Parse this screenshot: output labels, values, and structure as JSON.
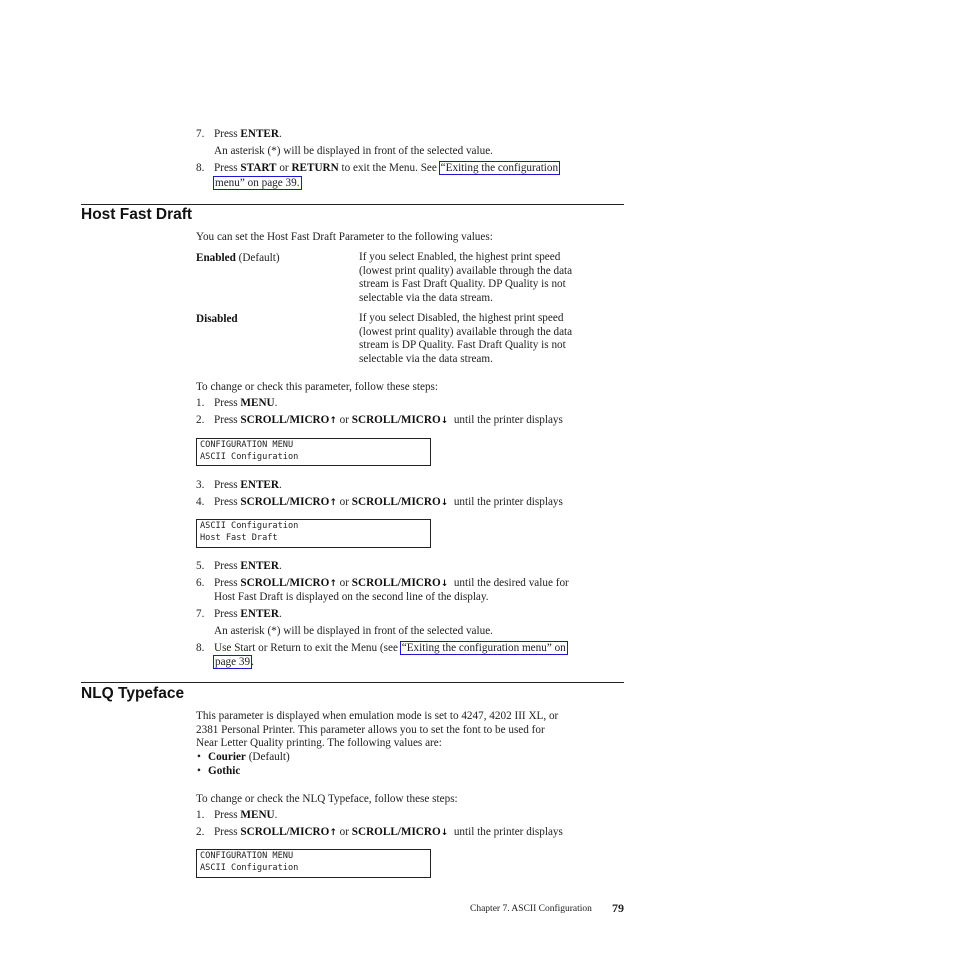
{
  "top_steps": {
    "step7": {
      "num": "7.",
      "pre": "Press ",
      "key": "ENTER",
      "post": "."
    },
    "step7_note": "An asterisk (*) will be displayed in front of the selected value.",
    "step8": {
      "num": "8.",
      "pre": "Press ",
      "key1": "START",
      "mid": " or ",
      "key2": "RETURN",
      "post": " to exit the Menu. See ",
      "link_line1": "“Exiting the configuration",
      "link_line2": "menu” on page 39."
    }
  },
  "host_fast_draft": {
    "title": "Host Fast Draft",
    "intro": "You can set the Host Fast Draft Parameter to the following values:",
    "values": [
      {
        "term": "Enabled",
        "term_suffix": " (Default)",
        "desc": [
          "If you select Enabled, the highest print speed",
          "(lowest print quality) available through the data",
          "stream is Fast Draft Quality. DP Quality is not",
          "selectable via the data stream."
        ]
      },
      {
        "term": "Disabled",
        "term_suffix": "",
        "desc": [
          "If you select Disabled, the highest print speed",
          "(lowest print quality) available through the data",
          "stream is DP Quality. Fast Draft Quality is not",
          "selectable via the data stream."
        ]
      }
    ],
    "steps_intro": "To change or check this parameter, follow these steps:",
    "step1": {
      "num": "1.",
      "pre": "Press ",
      "key": "MENU",
      "post": "."
    },
    "step2": {
      "num": "2.",
      "pre": "Press ",
      "key1": "SCROLL/MICRO",
      "arrow_up": "↑",
      "mid": " or ",
      "key2": "SCROLL/MICRO",
      "arrow_down": "↓",
      "post": "  until the printer displays"
    },
    "display1": [
      "CONFIGURATION MENU",
      "ASCII Configuration"
    ],
    "step3": {
      "num": "3.",
      "pre": "Press ",
      "key": "ENTER",
      "post": "."
    },
    "step4": {
      "num": "4.",
      "pre": "Press ",
      "key1": "SCROLL/MICRO",
      "arrow_up": "↑",
      "mid": " or ",
      "key2": "SCROLL/MICRO",
      "arrow_down": "↓",
      "post": "  until the printer displays"
    },
    "display2": [
      "ASCII Configuration",
      "Host Fast Draft"
    ],
    "step5": {
      "num": "5.",
      "pre": "Press ",
      "key": "ENTER",
      "post": "."
    },
    "step6": {
      "num": "6.",
      "pre": "Press ",
      "key1": "SCROLL/MICRO",
      "arrow_up": "↑",
      "mid": " or ",
      "key2": "SCROLL/MICRO",
      "arrow_down": "↓",
      "post": "  until the desired value for",
      "line2": "Host Fast Draft is displayed on the second line of the display."
    },
    "step7": {
      "num": "7.",
      "pre": "Press ",
      "key": "ENTER",
      "post": "."
    },
    "step7_note": "An asterisk (*) will be displayed in front of the selected value.",
    "step8": {
      "num": "8.",
      "pre": "Use Start or Return to exit the Menu (see ",
      "link_line1": "“Exiting the configuration menu” on",
      "link_line2": "page 39",
      "post": "."
    }
  },
  "nlq_typeface": {
    "title": "NLQ Typeface",
    "intro": [
      "This parameter is displayed when emulation mode is set to 4247, 4202 III XL, or",
      "2381 Personal Printer. This parameter allows you to set the font to be used for",
      "Near Letter Quality printing. The following values are:"
    ],
    "bullets": [
      {
        "term": "Courier",
        "suffix": " (Default)"
      },
      {
        "term": "Gothic",
        "suffix": ""
      }
    ],
    "bullet_char": "•",
    "steps_intro": "To change or check the NLQ Typeface, follow these steps:",
    "step1": {
      "num": "1.",
      "pre": "Press ",
      "key": "MENU",
      "post": "."
    },
    "step2": {
      "num": "2.",
      "pre": "Press ",
      "key1": "SCROLL/MICRO",
      "arrow_up": "↑",
      "mid": " or ",
      "key2": "SCROLL/MICRO",
      "arrow_down": "↓",
      "post": "  until the printer displays"
    },
    "display1": [
      "CONFIGURATION MENU",
      "ASCII Configuration"
    ]
  },
  "footer": {
    "chapter": "Chapter 7. ASCII Configuration",
    "page": "79"
  }
}
